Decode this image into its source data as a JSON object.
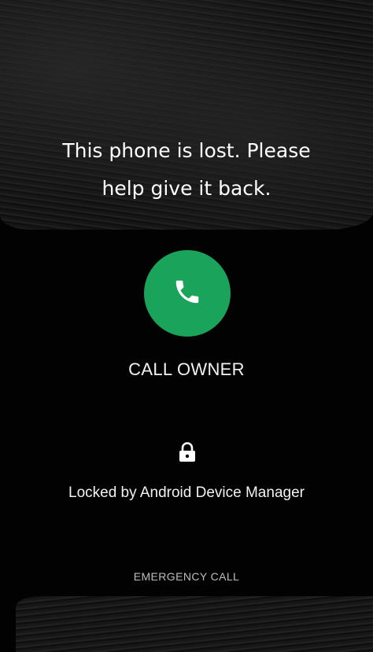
{
  "screen": {
    "message_lines": [
      "This phone is lost. Please",
      "help give it back."
    ],
    "call_button": {
      "icon": "phone-icon",
      "label": "CALL OWNER",
      "color": "#1aa35a"
    },
    "lock": {
      "icon": "lock-icon",
      "text": "Locked by Android Device Manager"
    },
    "emergency_call_label": "EMERGENCY CALL"
  }
}
